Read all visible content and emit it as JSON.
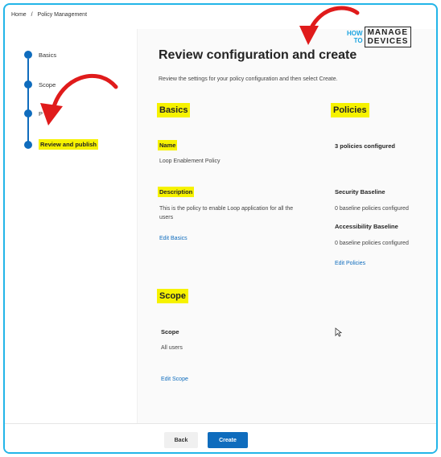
{
  "breadcrumb": {
    "home": "Home",
    "separator": "/",
    "current": "Policy Management"
  },
  "steps": [
    {
      "label": "Basics",
      "active": false
    },
    {
      "label": "Scope",
      "active": false
    },
    {
      "label": "P",
      "active": false
    },
    {
      "label": "Review and publish",
      "active": true
    }
  ],
  "page": {
    "title": "Review configuration and create",
    "description": "Review the settings for your policy configuration and then select Create."
  },
  "basics": {
    "heading": "Basics",
    "name_label": "Name",
    "name_value": "Loop Enablement Policy",
    "description_label": "Description",
    "description_value_line1": "This is the policy to enable Loop application for all the",
    "description_value_line2": "users",
    "edit_link": "Edit Basics"
  },
  "policies": {
    "heading": "Policies",
    "count": "3 policies configured",
    "security_label": "Security Baseline",
    "security_value": "0 baseline policies configured",
    "accessibility_label": "Accessibility Baseline",
    "accessibility_value": "0 baseline policies configured",
    "edit_link": "Edit Policies"
  },
  "scope": {
    "heading": "Scope",
    "label": "Scope",
    "value": "All users",
    "edit_link": "Edit Scope"
  },
  "footer": {
    "back": "Back",
    "create": "Create"
  },
  "logo": {
    "how": "HOW",
    "to": "TO",
    "manage": "MANAGE",
    "devices": "DEVICES"
  },
  "colors": {
    "accent": "#0f6cbd",
    "highlight": "#f6f200",
    "annotation": "#e01b1b",
    "frame": "#23b5e8"
  }
}
